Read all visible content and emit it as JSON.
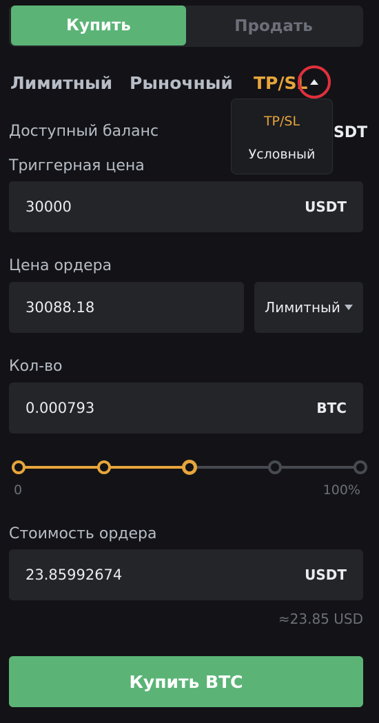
{
  "side_toggle": {
    "buy_label": "Купить",
    "sell_label": "Продать"
  },
  "order_types": {
    "limit": "Лимитный",
    "market": "Рыночный",
    "tpsl": "TP/SL"
  },
  "dropdown": {
    "items": [
      "TP/SL",
      "Условный"
    ]
  },
  "balance": {
    "label": "Доступный баланс",
    "unit_partial": "SDT"
  },
  "trigger_price": {
    "label": "Триггерная цена",
    "value": "30000",
    "unit": "USDT"
  },
  "order_price": {
    "label": "Цена ордера",
    "value": "30088.18",
    "type_select": "Лимитный"
  },
  "quantity": {
    "label": "Кол-во",
    "value": "0.000793",
    "unit": "BTC"
  },
  "slider": {
    "min_label": "0",
    "max_label": "100%",
    "level_percent": 50
  },
  "order_value": {
    "label": "Стоимость ордера",
    "value": "23.85992674",
    "unit": "USDT",
    "approx": "≈23.85 USD"
  },
  "submit": {
    "label": "Купить BTC"
  },
  "colors": {
    "buy_green": "#5bb476",
    "accent_orange": "#e6a53b",
    "highlight_red": "#e0303c",
    "background": "#131317",
    "field_bg": "#242529"
  }
}
